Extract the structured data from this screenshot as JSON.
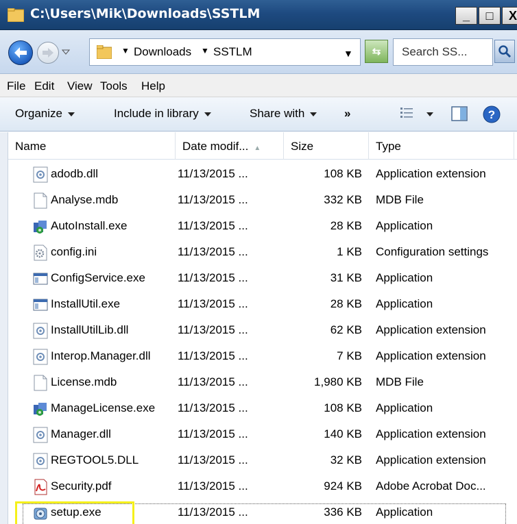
{
  "window": {
    "title": "C:\\Users\\Mik\\Downloads\\SSTLM",
    "minimize": "_",
    "maximize": "□",
    "close": "X"
  },
  "address": {
    "crumbs": [
      "Downloads",
      "SSTLM"
    ],
    "search_placeholder": "Search SS..."
  },
  "menu": [
    "File",
    "Edit",
    "View",
    "Tools",
    "Help"
  ],
  "commands": {
    "organize": "Organize",
    "include": "Include in library",
    "share": "Share with",
    "more": "»"
  },
  "columns": {
    "name": "Name",
    "date": "Date modif...",
    "size": "Size",
    "type": "Type"
  },
  "files": [
    {
      "name": "adodb.dll",
      "date": "11/13/2015 ...",
      "size": "108 KB",
      "type": "Application extension",
      "icon": "dll-icon"
    },
    {
      "name": "Analyse.mdb",
      "date": "11/13/2015 ...",
      "size": "332 KB",
      "type": "MDB File",
      "icon": "blank-file-icon"
    },
    {
      "name": "AutoInstall.exe",
      "date": "11/13/2015 ...",
      "size": "28 KB",
      "type": "Application",
      "icon": "installer-icon"
    },
    {
      "name": "config.ini",
      "date": "11/13/2015 ...",
      "size": "1 KB",
      "type": "Configuration settings",
      "icon": "settings-file-icon"
    },
    {
      "name": "ConfigService.exe",
      "date": "11/13/2015 ...",
      "size": "31 KB",
      "type": "Application",
      "icon": "exe-window-icon"
    },
    {
      "name": "InstallUtil.exe",
      "date": "11/13/2015 ...",
      "size": "28 KB",
      "type": "Application",
      "icon": "exe-window-icon"
    },
    {
      "name": "InstallUtilLib.dll",
      "date": "11/13/2015 ...",
      "size": "62 KB",
      "type": "Application extension",
      "icon": "dll-icon"
    },
    {
      "name": "Interop.Manager.dll",
      "date": "11/13/2015 ...",
      "size": "7 KB",
      "type": "Application extension",
      "icon": "dll-icon"
    },
    {
      "name": "License.mdb",
      "date": "11/13/2015 ...",
      "size": "1,980 KB",
      "type": "MDB File",
      "icon": "blank-file-icon"
    },
    {
      "name": "ManageLicense.exe",
      "date": "11/13/2015 ...",
      "size": "108 KB",
      "type": "Application",
      "icon": "installer-icon"
    },
    {
      "name": "Manager.dll",
      "date": "11/13/2015 ...",
      "size": "140 KB",
      "type": "Application extension",
      "icon": "dll-icon"
    },
    {
      "name": "REGTOOL5.DLL",
      "date": "11/13/2015 ...",
      "size": "32 KB",
      "type": "Application extension",
      "icon": "dll-icon"
    },
    {
      "name": "Security.pdf",
      "date": "11/13/2015 ...",
      "size": "924 KB",
      "type": "Adobe Acrobat Doc...",
      "icon": "pdf-icon"
    },
    {
      "name": "setup.exe",
      "date": "11/13/2015 ...",
      "size": "336 KB",
      "type": "Application",
      "icon": "setup-icon"
    }
  ],
  "colors": {
    "titlebar": "#1e4a80",
    "highlight": "#f5f01a"
  }
}
